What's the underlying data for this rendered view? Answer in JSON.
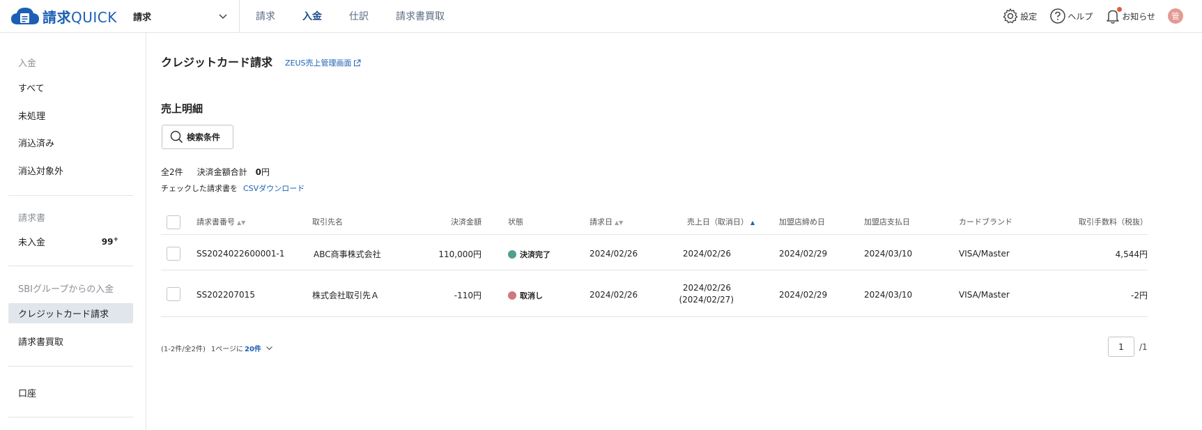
{
  "header": {
    "logo_kanji": "請求",
    "logo_latin": "QUICK",
    "product_select": "請求",
    "nav": [
      "請求",
      "入金",
      "仕訳",
      "請求書買取"
    ],
    "settings_label": "設定",
    "help_label": "ヘルプ",
    "notice_label": "お知らせ",
    "avatar_initial": "管"
  },
  "sidebar": {
    "section1_title": "入金",
    "section1_items": [
      "すべて",
      "未処理",
      "消込済み",
      "消込対象外"
    ],
    "section2_title": "請求書",
    "unpaid_label": "未入金",
    "unpaid_count": "99",
    "unpaid_plus": "+",
    "section3_title": "SBIグループからの入金",
    "credit_label": "クレジットカード請求",
    "factoring_label": "請求書買取",
    "account_label": "口座"
  },
  "main": {
    "title": "クレジットカード請求",
    "zeus_link": "ZEUS売上管理画面",
    "subtitle": "売上明細",
    "search_button": "検索条件",
    "total_count": "全2件",
    "settled_total_label": "決済金額合計",
    "settled_total_value": "0",
    "settled_total_unit": "円",
    "csv_prefix": "チェックした請求書を",
    "csv_link": "CSVダウンロード"
  },
  "table": {
    "headers": {
      "invoice_no": "請求書番号",
      "partner": "取引先名",
      "amount": "決済金額",
      "status": "状態",
      "billing_date": "請求日",
      "sales_date": "売上日（取消日）",
      "close_date": "加盟店締め日",
      "pay_date": "加盟店支払日",
      "brand": "カードブランド",
      "fee": "取引手数料（税抜）"
    },
    "rows": [
      {
        "invoice_no": "SS2024022600001-1",
        "partner": "ABC商事株式会社",
        "amount": "110,000円",
        "status": "決済完了",
        "billing_date": "2024/02/26",
        "sales_date": "2024/02/26",
        "cancel_date": "",
        "close_date": "2024/02/29",
        "pay_date": "2024/03/10",
        "brand": "VISA/Master",
        "fee": "4,544円"
      },
      {
        "invoice_no": "SS202207015",
        "partner": "株式会社取引先Ａ",
        "amount": "-110円",
        "status": "取消し",
        "billing_date": "2024/02/26",
        "sales_date": "2024/02/26",
        "cancel_date": "(2024/02/27)",
        "close_date": "2024/02/29",
        "pay_date": "2024/03/10",
        "brand": "VISA/Master",
        "fee": "-2円"
      }
    ]
  },
  "pagination": {
    "range": "(1-2件/全2件)",
    "per_page_label": "1ページに",
    "per_page_value": "20件",
    "current_page": "1",
    "total_pages": "/1"
  },
  "colors": {
    "brand_blue": "#1b5fb4",
    "status_done": "#4fa08f",
    "status_cancel": "#d0777d"
  }
}
